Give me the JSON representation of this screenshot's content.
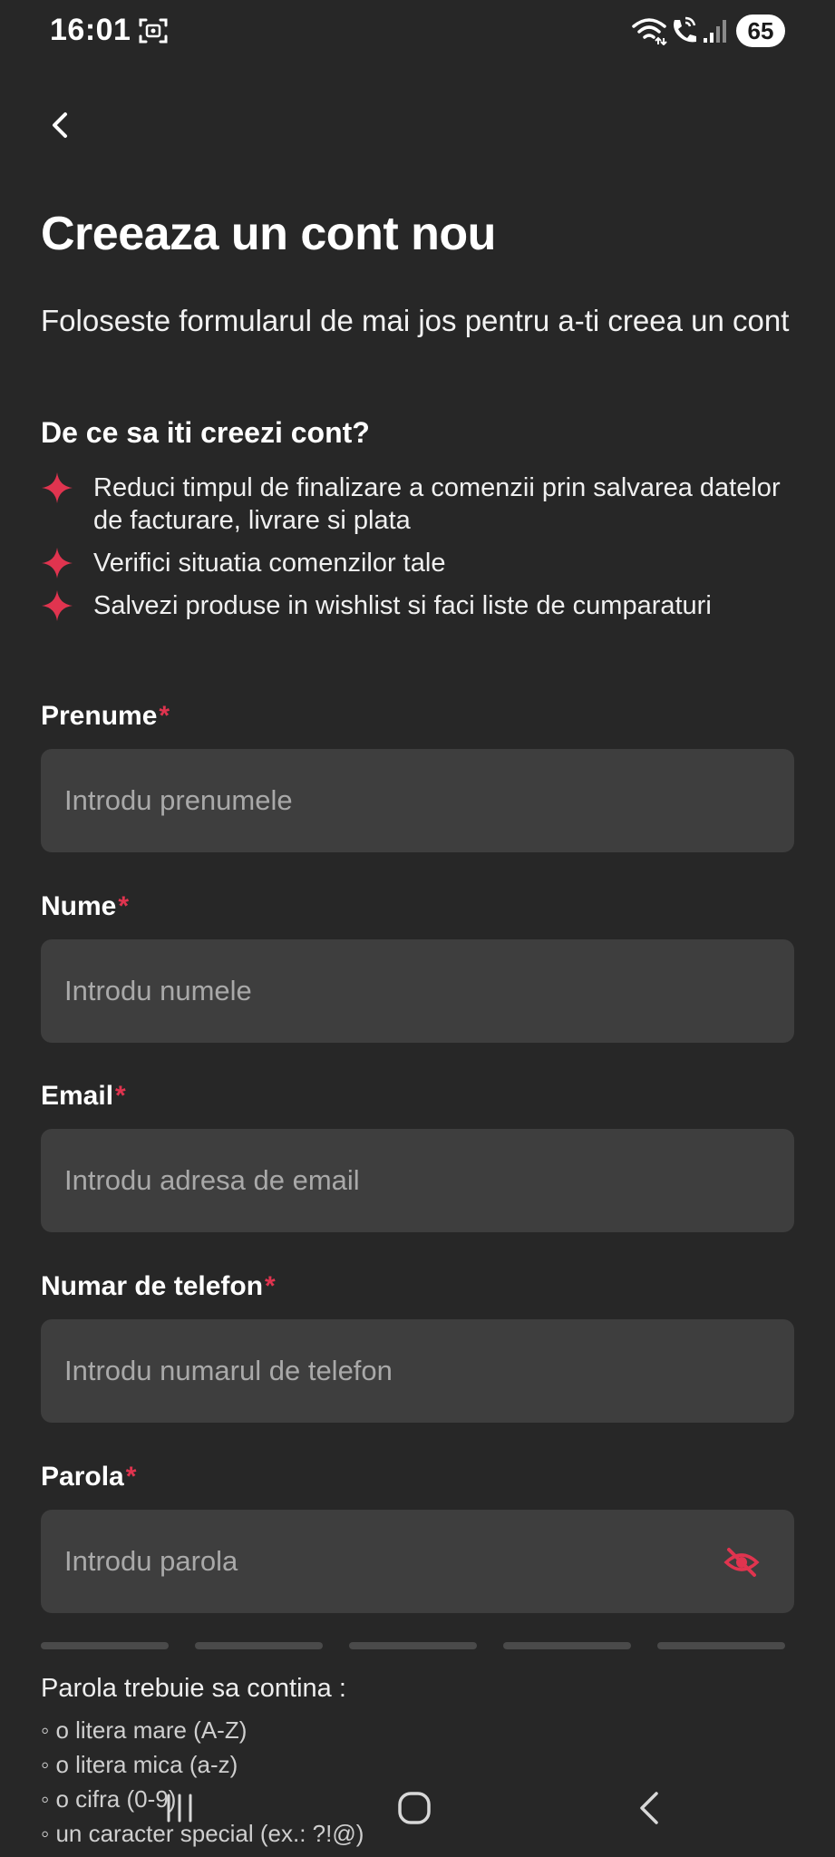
{
  "status_bar": {
    "time": "16:01",
    "battery": "65",
    "icons": [
      "screen-capture-icon",
      "wifi-icon",
      "wifi-call-icon",
      "signal-icon"
    ]
  },
  "header": {
    "back_icon": "chevron-left-icon"
  },
  "title": "Creeaza un cont nou",
  "subtitle": "Foloseste formularul de mai jos pentru a-ti creea un cont",
  "why_heading": "De ce sa iti creezi cont?",
  "benefits": [
    {
      "text": "Reduci timpul de finalizare a comenzii prin salvarea datelor de facturare, livrare si plata"
    },
    {
      "text": "Verifici situatia comenzilor tale"
    },
    {
      "text": "Salvezi produse in wishlist si faci liste de cumparaturi"
    }
  ],
  "form": {
    "required_marker": "*",
    "first_name": {
      "label": "Prenume",
      "placeholder": "Introdu prenumele",
      "value": ""
    },
    "last_name": {
      "label": "Nume",
      "placeholder": "Introdu numele",
      "value": ""
    },
    "email": {
      "label": "Email",
      "placeholder": "Introdu adresa de email",
      "value": ""
    },
    "phone": {
      "label": "Numar de telefon",
      "placeholder": "Introdu numarul de telefon",
      "value": ""
    },
    "password": {
      "label": "Parola",
      "placeholder": "Introdu parola",
      "value": "",
      "toggle_icon": "eye-off-icon"
    }
  },
  "password_strength": {
    "segments": 5,
    "filled": 0
  },
  "password_rules": {
    "heading": "Parola trebuie sa contina :",
    "items": [
      "◦ o litera mare (A-Z)",
      "◦ o litera mica (a-z)",
      "◦ o cifra (0-9)",
      "◦ un caracter special (ex.: ?!@)"
    ]
  },
  "colors": {
    "background": "#272727",
    "input_background": "#3e3e3e",
    "accent": "#e0344f",
    "placeholder": "#a9a9a9"
  }
}
